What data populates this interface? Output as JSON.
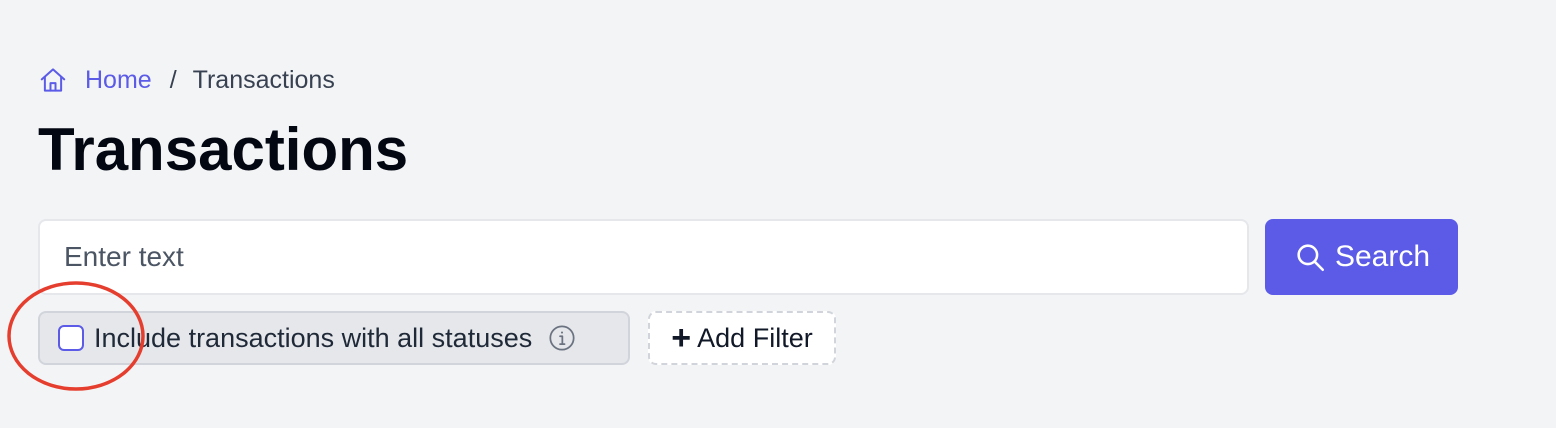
{
  "breadcrumb": {
    "home_icon": "home-icon",
    "home_label": "Home",
    "separator": "/",
    "current_label": "Transactions"
  },
  "page": {
    "title": "Transactions"
  },
  "search": {
    "placeholder": "Enter text",
    "value": "",
    "button_label": "Search",
    "button_icon": "search-icon"
  },
  "filters": {
    "status_checkbox_label": "Include transactions with all statuses",
    "status_checkbox_checked": false,
    "status_info_icon": "info-icon",
    "add_filter_label": "Add Filter",
    "add_filter_icon": "plus-icon"
  },
  "annotation": {
    "type": "highlight-circle",
    "color": "#e53e2e"
  },
  "colors": {
    "accent": "#5b5be8",
    "background": "#f3f4f6"
  }
}
